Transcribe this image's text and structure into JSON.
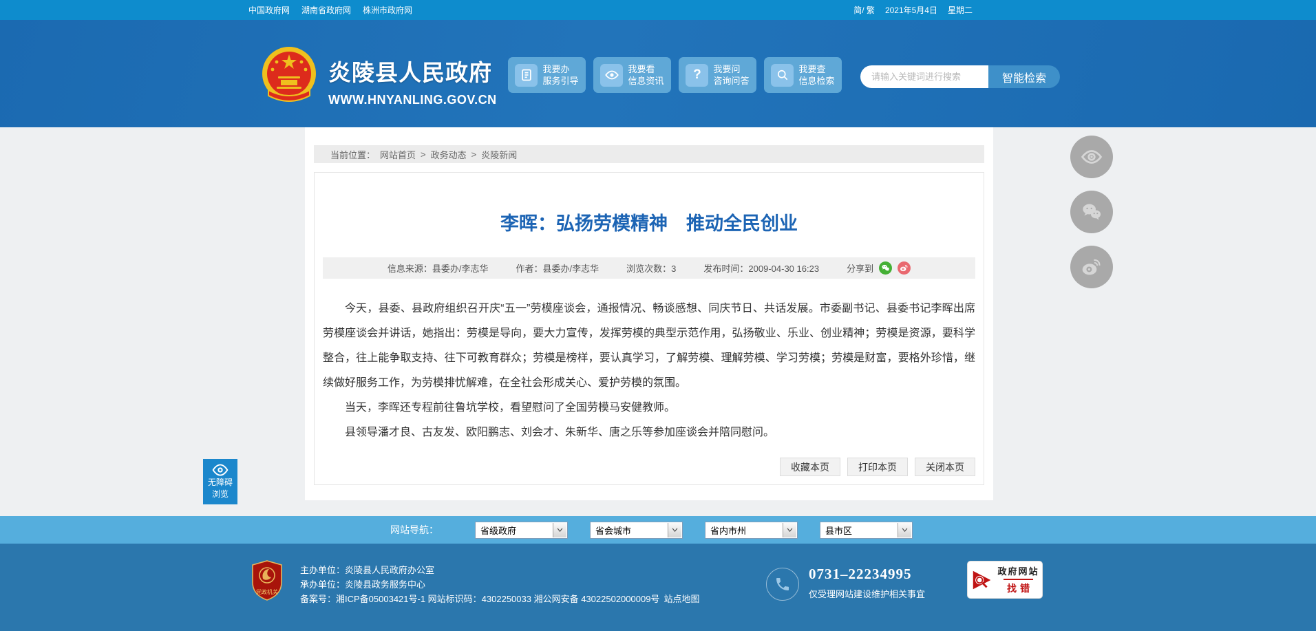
{
  "topbar": {
    "links": [
      "中国政府网",
      "湖南省政府网",
      "株洲市政府网"
    ],
    "lang": "简/ 繁",
    "date": "2021年5月4日",
    "weekday": "星期二"
  },
  "header": {
    "site_name": "炎陵县人民政府",
    "site_url": "WWW.HNYANLING.GOV.CN",
    "services": [
      {
        "line1": "我要办",
        "line2": "服务引导",
        "icon": "document-icon"
      },
      {
        "line1": "我要看",
        "line2": "信息资讯",
        "icon": "eye-icon"
      },
      {
        "line1": "我要问",
        "line2": "咨询问答",
        "icon": "question-icon"
      },
      {
        "line1": "我要查",
        "line2": "信息检索",
        "icon": "search-icon"
      }
    ],
    "search_placeholder": "请输入关键词进行搜索",
    "search_button": "智能检索"
  },
  "breadcrumb": {
    "label": "当前位置：",
    "separator": ">",
    "items": [
      "网站首页",
      "政务动态",
      "炎陵新闻"
    ]
  },
  "article": {
    "title": "李晖：弘扬劳模精神　推动全民创业",
    "meta": {
      "source": "信息来源：县委办/李志华",
      "author": "作者：县委办/李志华",
      "views": "浏览次数：3",
      "pubtime": "发布时间：2009-04-30 16:23",
      "share_label": "分享到"
    },
    "paragraphs": [
      "今天，县委、县政府组织召开庆“五一”劳模座谈会，通报情况、畅谈感想、同庆节日、共话发展。市委副书记、县委书记李晖出席劳模座谈会并讲话，她指出：劳模是导向，要大力宣传，发挥劳模的典型示范作用，弘扬敬业、乐业、创业精神；劳模是资源，要科学整合，往上能争取支持、往下可教育群众；劳模是榜样，要认真学习，了解劳模、理解劳模、学习劳模；劳模是财富，要格外珍惜，继续做好服务工作，为劳模排忧解难，在全社会形成关心、爱护劳模的氛围。",
      "当天，李晖还专程前往鲁坑学校，看望慰问了全国劳模马安健教师。",
      "县领导潘才良、古友发、欧阳鹏志、刘会才、朱新华、唐之乐等参加座谈会并陪同慰问。"
    ],
    "actions": [
      "收藏本页",
      "打印本页",
      "关闭本页"
    ]
  },
  "floats": {
    "accessibility_line1": "无障碍",
    "accessibility_line2": "浏览"
  },
  "footer_nav": {
    "label": "网站导航：",
    "selects": [
      "省级政府",
      "省会城市",
      "省内市州",
      "县市区"
    ]
  },
  "footer": {
    "badge_label": "党政机关",
    "host": "主办单位：炎陵县人民政府办公室",
    "organizer": "承办单位：炎陵县政务服务中心",
    "icp": "备案号：湘ICP备05003421号-1 网站标识码：4302250033 湘公网安备 43022502000009号",
    "sitemap": "站点地图",
    "phone": "0731–22234995",
    "phone_note": "仅受理网站建设维护相关事宜",
    "error_badge_line1": "政府网站",
    "error_badge_line2": "找错"
  },
  "colors": {
    "topbar": "#0e8ccd",
    "header": "#1e6fb6",
    "page_bg": "#eef0f2",
    "accent_blue": "#1c64b4",
    "footer_nav": "#55aedd",
    "footer": "#2b77ad",
    "wechat_green": "#45b035",
    "weibo_red": "#e9686f"
  }
}
